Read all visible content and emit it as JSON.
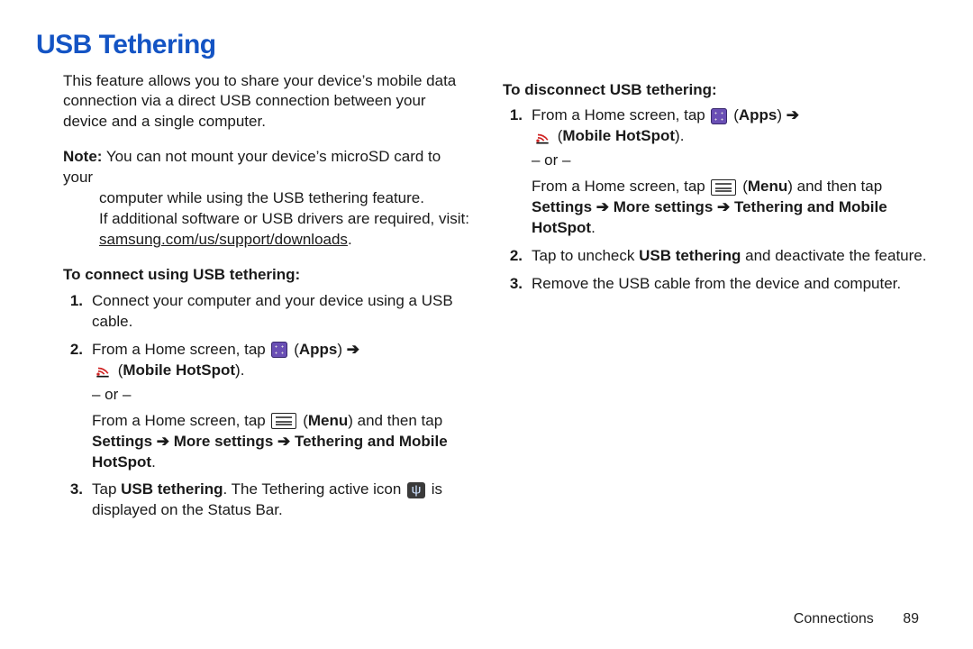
{
  "title": "USB Tethering",
  "intro": "This feature allows you to share your device’s mobile data connection via a direct USB connection between your device and a single computer.",
  "note": {
    "label": "Note:",
    "line1": "You can not mount your device’s microSD card to your",
    "line2": "computer while using the USB tethering feature.",
    "line3": "If additional software or USB drivers are required, visit:",
    "link": "samsung.com/us/support/downloads"
  },
  "connect": {
    "heading": "To connect using USB tethering:",
    "steps": {
      "s1": "Connect your computer and your device using a USB cable.",
      "s2a": "From a Home screen, tap ",
      "apps_label": "Apps",
      "arrow": " ➔",
      "hotspot_label": "Mobile HotSpot",
      "or": "– or –",
      "s2b": "From a Home screen, tap ",
      "menu_label": "Menu",
      "s2c": " and then tap ",
      "settings_path": "Settings ➔ More settings ➔ Tethering and Mobile HotSpot",
      "s3a": "Tap ",
      "usb_tethering": "USB tethering",
      "s3b": ". The Tethering active icon ",
      "s3c": " is displayed on the Status Bar."
    }
  },
  "disconnect": {
    "heading": "To disconnect USB tethering:",
    "steps": {
      "s1a": "From a Home screen, tap ",
      "apps_label": "Apps",
      "arrow": " ➔",
      "hotspot_label": "Mobile HotSpot",
      "or": "– or –",
      "s1b": "From a Home screen, tap ",
      "menu_label": "Menu",
      "s1c": " and then tap ",
      "settings_path": "Settings ➔ More settings ➔ Tethering and Mobile HotSpot",
      "s2a": "Tap to uncheck ",
      "usb_tethering": "USB tethering",
      "s2b": " and deactivate the feature.",
      "s3": "Remove the USB cable from the device and computer."
    }
  },
  "footer": {
    "section": "Connections",
    "page": "89"
  }
}
